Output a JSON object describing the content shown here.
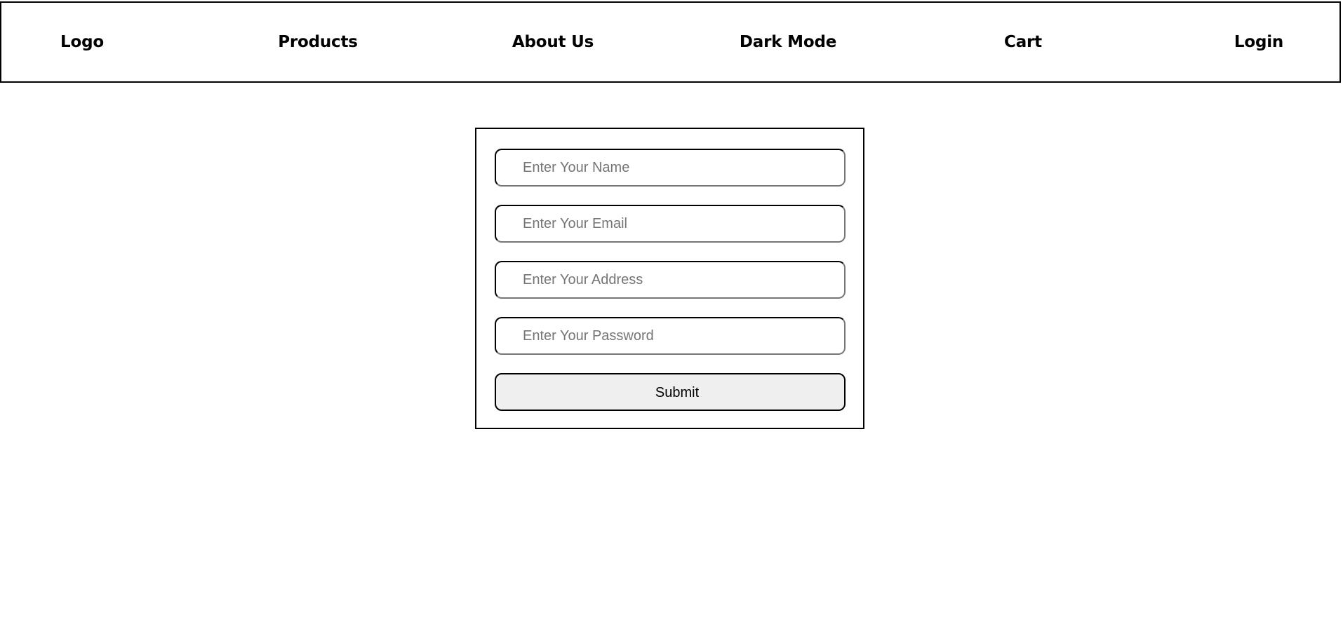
{
  "navbar": {
    "logo": "Logo",
    "products": "Products",
    "about": "About Us",
    "dark_mode": "Dark Mode",
    "cart": "Cart",
    "login": "Login"
  },
  "form": {
    "name_placeholder": "Enter Your Name",
    "email_placeholder": "Enter Your Email",
    "address_placeholder": "Enter Your Address",
    "password_placeholder": "Enter Your Password",
    "submit_label": "Submit"
  }
}
